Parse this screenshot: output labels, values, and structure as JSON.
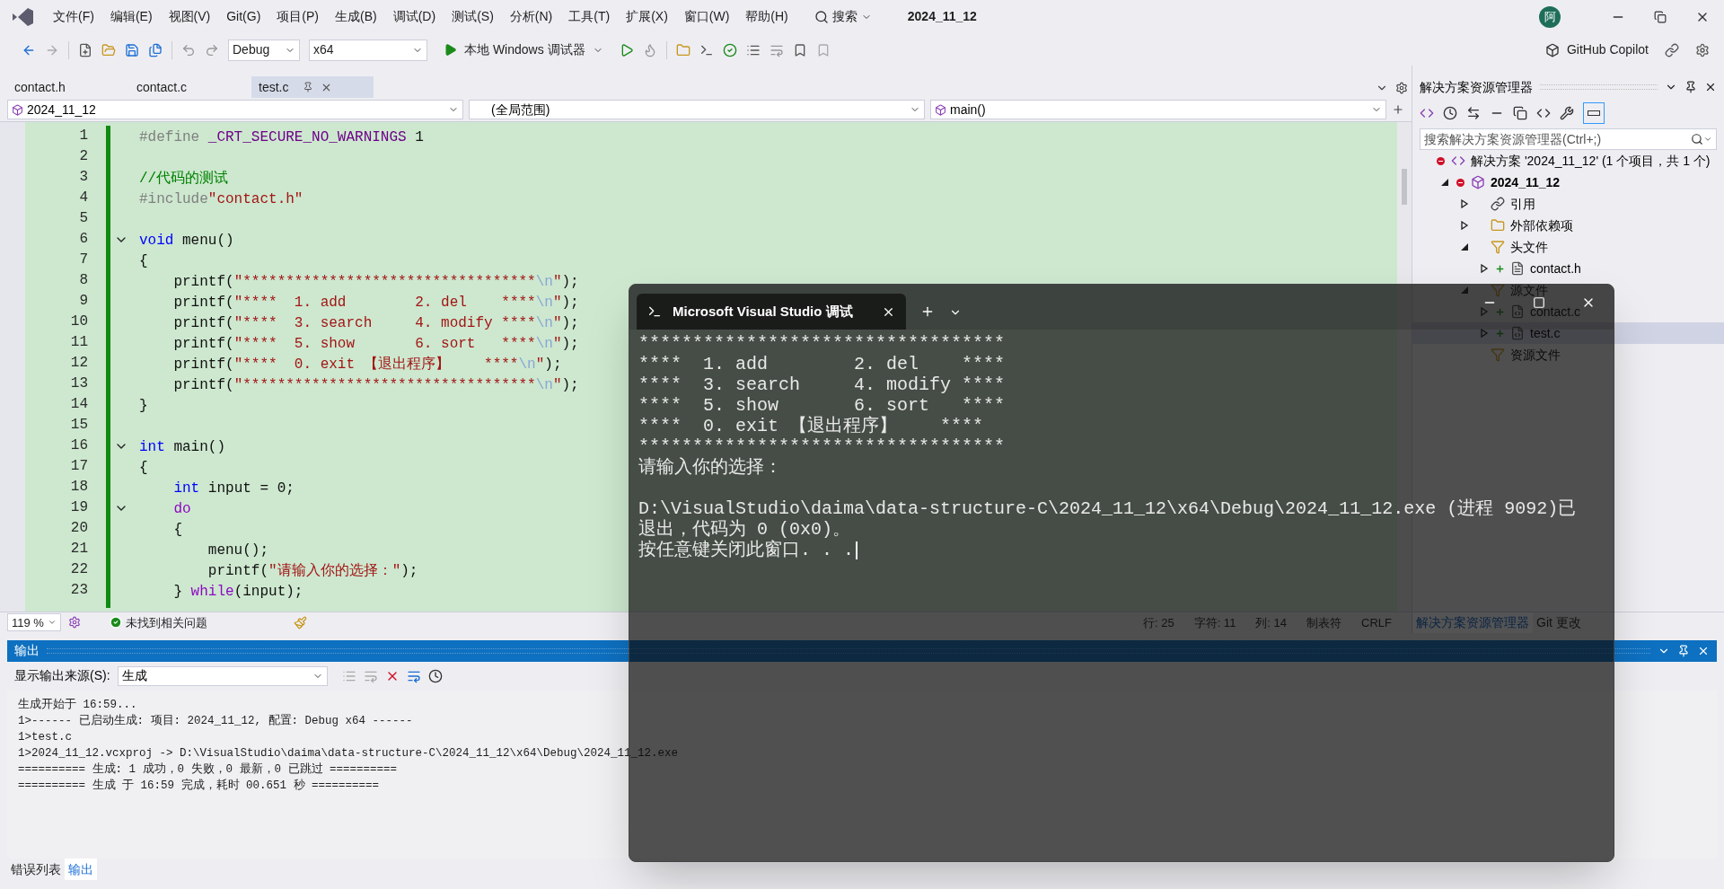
{
  "menu_bar": {
    "items": [
      "文件(F)",
      "编辑(E)",
      "视图(V)",
      "Git(G)",
      "项目(P)",
      "生成(B)",
      "调试(D)",
      "测试(S)",
      "分析(N)",
      "工具(T)",
      "扩展(X)",
      "窗口(W)",
      "帮助(H)"
    ],
    "search": "搜索",
    "solution_name": "2024_11_12",
    "avatar": "阿"
  },
  "toolbar": {
    "configuration": "Debug",
    "platform": "x64",
    "run_button": "本地 Windows 调试器",
    "copilot": "GitHub Copilot"
  },
  "document_tabs": [
    {
      "label": "contact.h",
      "selected": false
    },
    {
      "label": "contact.c",
      "selected": false
    },
    {
      "label": "test.c",
      "selected": true
    }
  ],
  "nav_bar": [
    "2024_11_12",
    "(全局范围)",
    "main()"
  ],
  "editor": {
    "lines": [
      {
        "number": "1",
        "fold": false,
        "tokens": [
          {
            "kind": "pp",
            "text": "#define "
          },
          {
            "kind": "macro",
            "text": "_CRT_SECURE_NO_WARNINGS"
          },
          {
            "kind": "txt",
            "text": " 1"
          }
        ]
      },
      {
        "number": "2",
        "fold": false
      },
      {
        "number": "3",
        "fold": false,
        "tokens": [
          {
            "kind": "com",
            "text": "//代码的测试"
          }
        ]
      },
      {
        "number": "4",
        "fold": false,
        "tokens": [
          {
            "kind": "pp",
            "text": "#include"
          },
          {
            "kind": "str",
            "text": "\"contact.h\""
          }
        ]
      },
      {
        "number": "5",
        "fold": false
      },
      {
        "number": "6",
        "fold": true,
        "tokens": [
          {
            "kind": "kw",
            "text": "void"
          },
          {
            "kind": "txt",
            "text": " menu()"
          }
        ]
      },
      {
        "number": "7",
        "fold": false,
        "tokens": [
          {
            "kind": "txt",
            "text": "{"
          }
        ]
      },
      {
        "number": "8",
        "fold": false,
        "tokens": [
          {
            "kind": "txt",
            "text": "    printf("
          },
          {
            "kind": "str",
            "text": "\"**********************************"
          },
          {
            "kind": "esc",
            "text": "\\n"
          },
          {
            "kind": "str",
            "text": "\""
          },
          {
            "kind": "txt",
            "text": ");"
          }
        ]
      },
      {
        "number": "9",
        "fold": false,
        "tokens": [
          {
            "kind": "txt",
            "text": "    printf("
          },
          {
            "kind": "str",
            "text": "\"****  1. add        2. del    ****"
          },
          {
            "kind": "esc",
            "text": "\\n"
          },
          {
            "kind": "str",
            "text": "\""
          },
          {
            "kind": "txt",
            "text": ");"
          }
        ]
      },
      {
        "number": "10",
        "fold": false,
        "tokens": [
          {
            "kind": "txt",
            "text": "    printf("
          },
          {
            "kind": "str",
            "text": "\"****  3. search     4. modify ****"
          },
          {
            "kind": "esc",
            "text": "\\n"
          },
          {
            "kind": "str",
            "text": "\""
          },
          {
            "kind": "txt",
            "text": ");"
          }
        ]
      },
      {
        "number": "11",
        "fold": false,
        "tokens": [
          {
            "kind": "txt",
            "text": "    printf("
          },
          {
            "kind": "str",
            "text": "\"****  5. show       6. sort   ****"
          },
          {
            "kind": "esc",
            "text": "\\n"
          },
          {
            "kind": "str",
            "text": "\""
          },
          {
            "kind": "txt",
            "text": ");"
          }
        ]
      },
      {
        "number": "12",
        "fold": false,
        "tokens": [
          {
            "kind": "txt",
            "text": "    printf("
          },
          {
            "kind": "str",
            "text": "\"****  0. exit 【退出程序】    ****"
          },
          {
            "kind": "esc",
            "text": "\\n"
          },
          {
            "kind": "str",
            "text": "\""
          },
          {
            "kind": "txt",
            "text": ");"
          }
        ]
      },
      {
        "number": "13",
        "fold": false,
        "tokens": [
          {
            "kind": "txt",
            "text": "    printf("
          },
          {
            "kind": "str",
            "text": "\"**********************************"
          },
          {
            "kind": "esc",
            "text": "\\n"
          },
          {
            "kind": "str",
            "text": "\""
          },
          {
            "kind": "txt",
            "text": ");"
          }
        ]
      },
      {
        "number": "14",
        "fold": false,
        "tokens": [
          {
            "kind": "txt",
            "text": "}"
          }
        ]
      },
      {
        "number": "15",
        "fold": false
      },
      {
        "number": "16",
        "fold": true,
        "tokens": [
          {
            "kind": "kw",
            "text": "int"
          },
          {
            "kind": "txt",
            "text": " main()"
          }
        ]
      },
      {
        "number": "17",
        "fold": false,
        "tokens": [
          {
            "kind": "txt",
            "text": "{"
          }
        ]
      },
      {
        "number": "18",
        "fold": false,
        "tokens": [
          {
            "kind": "kw",
            "text": "    int"
          },
          {
            "kind": "txt",
            "text": " input = 0;"
          }
        ]
      },
      {
        "number": "19",
        "fold": true,
        "tokens": [
          {
            "kind": "ctl",
            "text": "    do"
          }
        ]
      },
      {
        "number": "20",
        "fold": false,
        "tokens": [
          {
            "kind": "txt",
            "text": "    {"
          }
        ]
      },
      {
        "number": "21",
        "fold": false,
        "tokens": [
          {
            "kind": "txt",
            "text": "        menu();"
          }
        ]
      },
      {
        "number": "22",
        "fold": false,
        "tokens": [
          {
            "kind": "txt",
            "text": "        printf("
          },
          {
            "kind": "str",
            "text": "\"请输入你的选择：\""
          },
          {
            "kind": "txt",
            "text": ");"
          }
        ]
      },
      {
        "number": "23",
        "fold": false,
        "tokens": [
          {
            "kind": "txt",
            "text": "    } "
          },
          {
            "kind": "ctl",
            "text": "while"
          },
          {
            "kind": "txt",
            "text": "(input);"
          }
        ]
      }
    ]
  },
  "editor_status": {
    "zoom": "119 %",
    "issues": "未找到相关问题",
    "fields": [
      "行: 25",
      "字符: 11",
      "列: 14",
      "制表符",
      "CRLF"
    ]
  },
  "explorer": {
    "title": "解决方案资源管理器",
    "search_placeholder": "搜索解决方案资源管理器(Ctrl+;)",
    "tree": [
      {
        "label": "解决方案 '2024_11_12' (1 个项目，共 1 个)",
        "kind": "solution",
        "excluded": true,
        "added": false,
        "selected": false,
        "children": [
          {
            "label": "2024_11_12",
            "kind": "project",
            "excluded": true,
            "added": false,
            "expanded": true,
            "selected": false,
            "children": [
              {
                "label": "引用",
                "kind": "references",
                "excluded": false,
                "added": false,
                "expanded": false,
                "selected": false
              },
              {
                "label": "外部依赖项",
                "kind": "external",
                "excluded": false,
                "added": false,
                "expanded": false,
                "selected": false
              },
              {
                "label": "头文件",
                "kind": "folder",
                "excluded": false,
                "added": false,
                "expanded": true,
                "selected": false,
                "children": [
                  {
                    "label": "contact.h",
                    "kind": "header",
                    "excluded": false,
                    "added": true,
                    "expanded": false,
                    "selected": false
                  }
                ]
              },
              {
                "label": "源文件",
                "kind": "folder",
                "excluded": false,
                "added": false,
                "expanded": true,
                "selected": false,
                "children": [
                  {
                    "label": "contact.c",
                    "kind": "source",
                    "excluded": false,
                    "added": true,
                    "expanded": false,
                    "selected": false
                  },
                  {
                    "label": "test.c",
                    "kind": "source",
                    "excluded": false,
                    "added": true,
                    "expanded": false,
                    "selected": true
                  }
                ]
              },
              {
                "label": "资源文件",
                "kind": "folder",
                "excluded": false,
                "added": false,
                "selected": false
              }
            ]
          }
        ]
      }
    ],
    "bottom_tabs": [
      {
        "label": "解决方案资源管理器",
        "selected": true
      },
      {
        "label": "Git 更改",
        "selected": false
      }
    ]
  },
  "output": {
    "title": "输出",
    "source_label": "显示输出来源(S):",
    "source_value": "生成",
    "lines": [
      "生成开始于 16:59...",
      "1>------ 已启动生成: 项目: 2024_11_12, 配置: Debug x64 ------",
      "1>test.c",
      "1>2024_11_12.vcxproj -> D:\\VisualStudio\\daima\\data-structure-C\\2024_11_12\\x64\\Debug\\2024_11_12.exe",
      "========== 生成: 1 成功，0 失败，0 最新，0 已跳过 ==========",
      "========== 生成 于 16:59 完成，耗时 00.651 秒 =========="
    ]
  },
  "panel_tabs": [
    {
      "label": "错误列表",
      "selected": false
    },
    {
      "label": "输出",
      "selected": true
    }
  ],
  "console": {
    "title": "Microsoft Visual Studio 调试",
    "output_blocks": [
      [
        "**********************************",
        "****  1. add        2. del    ****",
        "****  3. search     4. modify ****",
        "****  5. show       6. sort   ****",
        "****  0. exit 【退出程序】    ****",
        "**********************************",
        "请输入你的选择："
      ],
      [
        "D:\\VisualStudio\\daima\\data-structure-C\\2024_11_12\\x64\\Debug\\2024_11_12.exe (进程 9092)已",
        "退出，代码为 0 (0x0)。",
        "按任意键关闭此窗口. . ."
      ]
    ]
  }
}
